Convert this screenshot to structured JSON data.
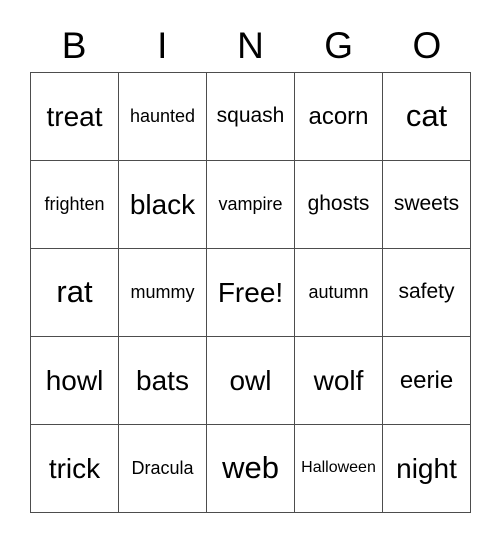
{
  "card": {
    "title": "BINGO",
    "header_letters": [
      "B",
      "I",
      "N",
      "G",
      "O"
    ],
    "grid_size": "5x5",
    "free_space_label": "Free!",
    "colors": {
      "grid_line": "#4d4d4d",
      "text": "#000000",
      "background": "#ffffff"
    },
    "rows": [
      [
        {
          "label": "treat",
          "size": "lg"
        },
        {
          "label": "haunted",
          "size": "xs"
        },
        {
          "label": "squash",
          "size": "sm"
        },
        {
          "label": "acorn",
          "size": "md"
        },
        {
          "label": "cat",
          "size": "xl"
        }
      ],
      [
        {
          "label": "frighten",
          "size": "xs"
        },
        {
          "label": "black",
          "size": "lg"
        },
        {
          "label": "vampire",
          "size": "xs"
        },
        {
          "label": "ghosts",
          "size": "sm"
        },
        {
          "label": "sweets",
          "size": "sm"
        }
      ],
      [
        {
          "label": "rat",
          "size": "xl"
        },
        {
          "label": "mummy",
          "size": "xs"
        },
        {
          "label": "Free!",
          "size": "lg"
        },
        {
          "label": "autumn",
          "size": "xs"
        },
        {
          "label": "safety",
          "size": "sm"
        }
      ],
      [
        {
          "label": "howl",
          "size": "lg"
        },
        {
          "label": "bats",
          "size": "lg"
        },
        {
          "label": "owl",
          "size": "lg"
        },
        {
          "label": "wolf",
          "size": "lg"
        },
        {
          "label": "eerie",
          "size": "md"
        }
      ],
      [
        {
          "label": "trick",
          "size": "lg"
        },
        {
          "label": "Dracula",
          "size": "xs"
        },
        {
          "label": "web",
          "size": "xl"
        },
        {
          "label": "Halloween",
          "size": "xxs"
        },
        {
          "label": "night",
          "size": "lg"
        }
      ]
    ]
  }
}
